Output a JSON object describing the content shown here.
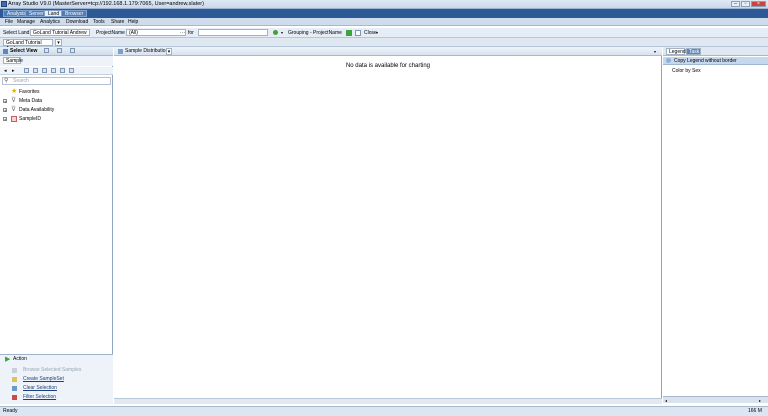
{
  "window": {
    "title": "Array Studio V9.0 (MasterServer=tcp://192.168.1.179:7065, User=andrew.slater)"
  },
  "top_tabs": [
    "Analysis",
    "Server",
    "Land",
    "Browser"
  ],
  "active_tab": "Land",
  "menu": [
    "File",
    "Manage",
    "Analytics",
    "Download",
    "Tools",
    "Share",
    "Help"
  ],
  "toolbar": {
    "select_land_label": "Select Land",
    "land_value": "GoLand Tutorial Andrew",
    "projectname_label": "ProjectName",
    "projectname_value": "(All)",
    "ellipsis": "···",
    "for_label": "for",
    "grouping_label": "Grouping - ProjectName",
    "close_label": "Close"
  },
  "land_tab": "GoLand Tutorial Andrew",
  "left_panel": {
    "select_view_label": "Select View",
    "sample_tab": "Sample",
    "search_placeholder": "Search",
    "tree": [
      {
        "label": "Favorites",
        "expandable": false,
        "icon": "star-icon"
      },
      {
        "label": "Meta Data",
        "expandable": true,
        "icon": "filter-icon"
      },
      {
        "label": "Data Availability",
        "expandable": true,
        "icon": "filter-icon"
      },
      {
        "label": "SampleID",
        "expandable": true,
        "icon": "list-icon"
      }
    ],
    "actions_title": "Action",
    "actions": [
      {
        "label": "Browse Selected Samples",
        "disabled": true
      },
      {
        "label": "Create SampleSet",
        "disabled": false
      },
      {
        "label": "Clear Selection",
        "disabled": false
      },
      {
        "label": "Filter Selection",
        "disabled": false
      }
    ]
  },
  "center": {
    "tab_label": "Sample Distribution",
    "no_data": "No data is available for charting"
  },
  "right_panel": {
    "tabs": [
      "Legend",
      "Task"
    ],
    "copy_legend": "Copy Legend",
    "without_border": "without border",
    "color_by": "Color by Sex"
  },
  "status": {
    "left": "Ready",
    "right": "166 M"
  },
  "colors": {
    "title_bar": "#2d5a96",
    "accent": "#c6d8ee"
  }
}
